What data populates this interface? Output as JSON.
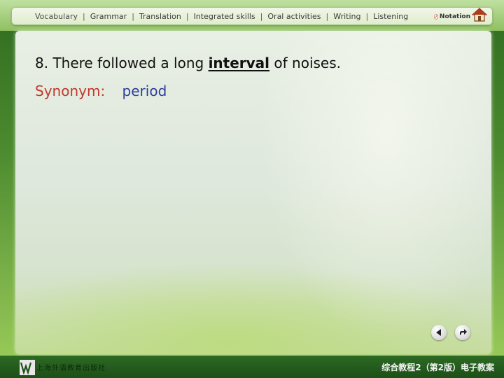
{
  "nav": {
    "items": [
      {
        "label": "Vocabulary",
        "active": true
      },
      {
        "label": "Grammar"
      },
      {
        "label": "Translation"
      },
      {
        "label": "Integrated skills"
      },
      {
        "label": "Oral activities"
      },
      {
        "label": "Writing"
      },
      {
        "label": "Listening"
      }
    ],
    "separator": "|",
    "notation_label": "Notation",
    "notation_icon": "pencil-icon",
    "home_icon": "home-icon"
  },
  "content": {
    "sentence_prefix": "8. There followed a long",
    "keyword": "interval",
    "sentence_suffix": "of noises.",
    "synonym_label": "Synonym:",
    "synonym_value": "period"
  },
  "controls": {
    "back_icon": "back-arrow-icon",
    "forward_icon": "forward-arrow-icon"
  },
  "footer": {
    "publisher": "上海外语教育出版社",
    "course": "综合教程2（第2版）电子教案"
  },
  "colors": {
    "synonym_label": "#c0392b",
    "synonym_value": "#2c3e9a",
    "footer_bg": "#1d4f17"
  }
}
